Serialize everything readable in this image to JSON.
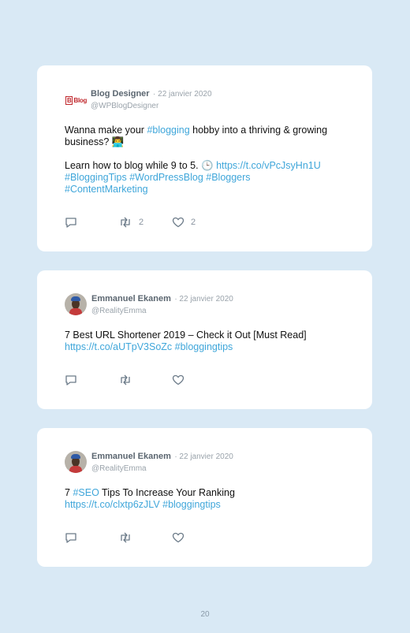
{
  "tweets": [
    {
      "name": "Blog Designer",
      "date": "· 22 janvier 2020",
      "handle": "@WPBlogDesigner",
      "avatar_text": "Blog",
      "line1_pre": "Wanna make your ",
      "line1_link": "#blogging",
      "line1_post": " hobby into a thriving & growing business? 👨‍💻",
      "line2_pre": "Learn how to blog while 9 to 5. 🕒 ",
      "line2_link": "https://t.co/vPcJsyHn1U",
      "line3": "#BloggingTips #WordPressBlog #Bloggers",
      "line4": "#ContentMarketing",
      "retweets": "2",
      "likes": "2"
    },
    {
      "name": "Emmanuel Ekanem",
      "date": "· 22 janvier 2020",
      "handle": "@RealityEmma",
      "text": "7 Best URL Shortener 2019 – Check it Out [Must Read]",
      "link": "https://t.co/aUTpV3SoZc #bloggingtips"
    },
    {
      "name": "Emmanuel Ekanem",
      "date": "· 22 janvier 2020",
      "handle": "@RealityEmma",
      "text_pre": "7 ",
      "text_link": "#SEO",
      "text_post": " Tips To Increase Your Ranking",
      "link": "https://t.co/clxtp6zJLV #bloggingtips"
    }
  ],
  "page_number": "20",
  "colors": {
    "background": "#d9e9f5",
    "link": "#3fa6da",
    "card": "#ffffff"
  }
}
